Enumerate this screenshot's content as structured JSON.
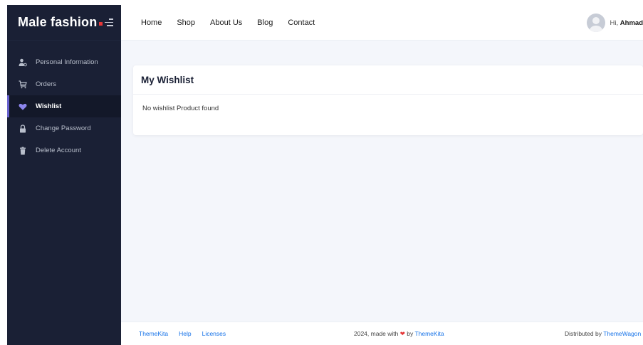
{
  "brand": {
    "name": "Male fashion",
    "accent_color": "#e53637"
  },
  "sidebar": {
    "background": "#1a2035",
    "items": [
      {
        "label": "Personal Information",
        "icon": "user-cog-icon",
        "active": false
      },
      {
        "label": "Orders",
        "icon": "cart-icon",
        "active": false
      },
      {
        "label": "Wishlist",
        "icon": "heart-icon",
        "active": true
      },
      {
        "label": "Change Password",
        "icon": "lock-icon",
        "active": false
      },
      {
        "label": "Delete Account",
        "icon": "trash-icon",
        "active": false
      }
    ]
  },
  "topnav": {
    "links": [
      "Home",
      "Shop",
      "About Us",
      "Blog",
      "Contact"
    ],
    "greeting": "Hi,",
    "user_name": "Ahmad"
  },
  "wishlist": {
    "title": "My Wishlist",
    "empty_message": "No wishlist Product found"
  },
  "footer": {
    "links": [
      "ThemeKita",
      "Help",
      "Licenses"
    ],
    "made_prefix": "2024, made with",
    "made_by": "by",
    "made_link": "ThemeKita",
    "distributed_prefix": "Distributed by",
    "distributed_link": "ThemeWagon",
    "link_color": "#1572e8"
  }
}
